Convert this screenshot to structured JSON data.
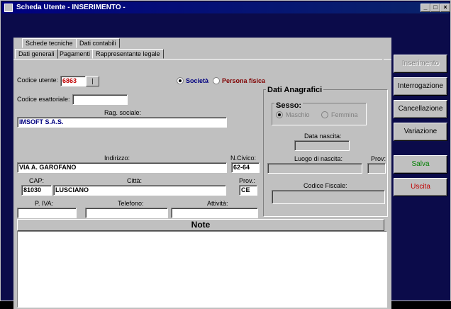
{
  "window": {
    "title": "Scheda Utente - INSERIMENTO -"
  },
  "tabs": {
    "row1": [
      "Schede tecniche",
      "Dati contabili"
    ],
    "row2": [
      "Dati generali",
      "Pagamenti",
      "Rappresentante legale"
    ]
  },
  "labels": {
    "codice_utente": "Codice utente:",
    "codice_esattoriale": "Codice esattoriale:",
    "rag_sociale": "Rag. sociale:",
    "indirizzo": "Indirizzo:",
    "ncivico": "N.Civico:",
    "cap": "CAP:",
    "citta": "Città:",
    "prov": "Prov.:",
    "piva": "P. IVA:",
    "telefono": "Telefono:",
    "attivita": "Attività:",
    "note": "Note"
  },
  "values": {
    "codice_utente": "6863",
    "codice_esattoriale": "",
    "rag_sociale": "IMSOFT S.A.S.",
    "indirizzo": "VIA A. GAROFANO",
    "ncivico": "62-64",
    "cap": "81030",
    "citta": "LUSCIANO",
    "prov": "CE",
    "piva": "",
    "telefono": "",
    "attivita": ""
  },
  "tipo": {
    "societa": "Società",
    "persona_fisica": "Persona fisica",
    "selected": "societa"
  },
  "anagrafici": {
    "title": "Dati Anagrafici",
    "sesso": "Sesso:",
    "maschio": "Maschio",
    "femmina": "Femmina",
    "data_nascita": "Data nascita:",
    "luogo_nascita": "Luogo di nascita:",
    "prov": "Prov:",
    "codice_fiscale": "Codice Fiscale:"
  },
  "buttons": {
    "inserimento": "Inserimento",
    "interrogazione": "Interrogazione",
    "cancellazione": "Cancellazione",
    "variazione": "Variazione",
    "salva": "Salva",
    "uscita": "Uscita"
  },
  "colors": {
    "salva": "#008000",
    "uscita": "#c00000",
    "societa": "#000080",
    "persona_fisica": "#800000",
    "codice_utente_text": "#c00000"
  }
}
